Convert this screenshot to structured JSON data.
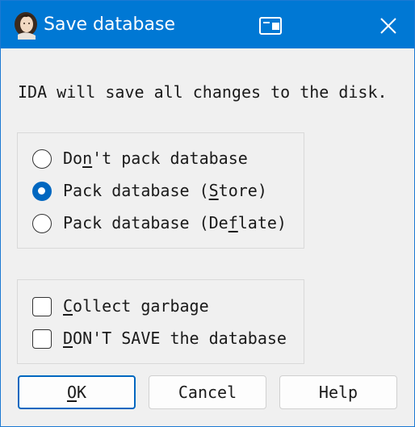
{
  "window": {
    "title": "Save database",
    "accent_color": "#0078d4",
    "app_icon": "ida-portrait-icon",
    "pin_icon": "pin-window-icon",
    "close_icon": "close-icon"
  },
  "message": "IDA will save all changes to the disk.",
  "pack_group": {
    "options": [
      {
        "pre": "Do",
        "key": "n",
        "post": "'t pack database",
        "checked": false
      },
      {
        "pre": "Pack database (",
        "key": "S",
        "post": "tore)",
        "checked": true
      },
      {
        "pre": "Pack database (De",
        "key": "f",
        "post": "late)",
        "checked": false
      }
    ]
  },
  "extra_group": {
    "options": [
      {
        "pre": "",
        "key": "C",
        "post": "ollect garbage",
        "checked": false
      },
      {
        "pre": "",
        "key": "D",
        "post": "ON'T SAVE the database",
        "checked": false
      }
    ]
  },
  "buttons": {
    "ok": {
      "key": "O",
      "post": "K"
    },
    "cancel": "Cancel",
    "help": "Help"
  }
}
